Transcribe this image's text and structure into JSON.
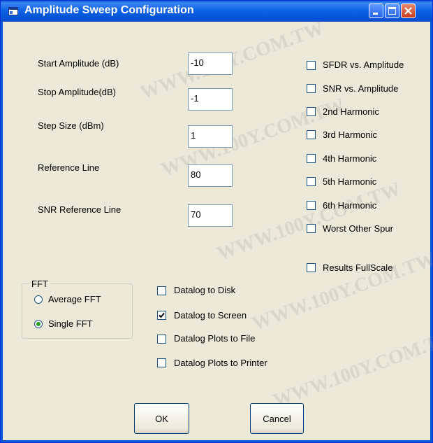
{
  "window": {
    "title": "Amplitude Sweep Configuration"
  },
  "fields": [
    {
      "label": "Start Amplitude (dB)",
      "value": "-10"
    },
    {
      "label": "Stop Amplitude(dB)",
      "value": "-1"
    },
    {
      "label": "Step Size (dBm)",
      "value": "1"
    },
    {
      "label": "Reference Line",
      "value": "80"
    },
    {
      "label": "SNR Reference Line",
      "value": "70"
    }
  ],
  "plot_options": [
    {
      "label": "SFDR vs. Amplitude",
      "checked": false
    },
    {
      "label": "SNR vs. Amplitude",
      "checked": false
    },
    {
      "label": "2nd Harmonic",
      "checked": false
    },
    {
      "label": "3rd Harmonic",
      "checked": false
    },
    {
      "label": "4th Harmonic",
      "checked": false
    },
    {
      "label": "5th Harmonic",
      "checked": false
    },
    {
      "label": "6th Harmonic",
      "checked": false
    },
    {
      "label": "Worst Other Spur",
      "checked": false
    },
    {
      "label": "Results FullScale",
      "checked": false
    }
  ],
  "fft": {
    "title": "FFT",
    "options": [
      {
        "label": "Average FFT",
        "selected": false
      },
      {
        "label": "Single FFT",
        "selected": true
      }
    ]
  },
  "datalog": [
    {
      "label": "Datalog to Disk",
      "checked": false
    },
    {
      "label": "Datalog to Screen",
      "checked": true
    },
    {
      "label": "Datalog Plots to File",
      "checked": false
    },
    {
      "label": "Datalog Plots to Printer",
      "checked": false
    }
  ],
  "buttons": {
    "ok": "OK",
    "cancel": "Cancel"
  },
  "watermark": "WWW.100Y.COM.TW"
}
